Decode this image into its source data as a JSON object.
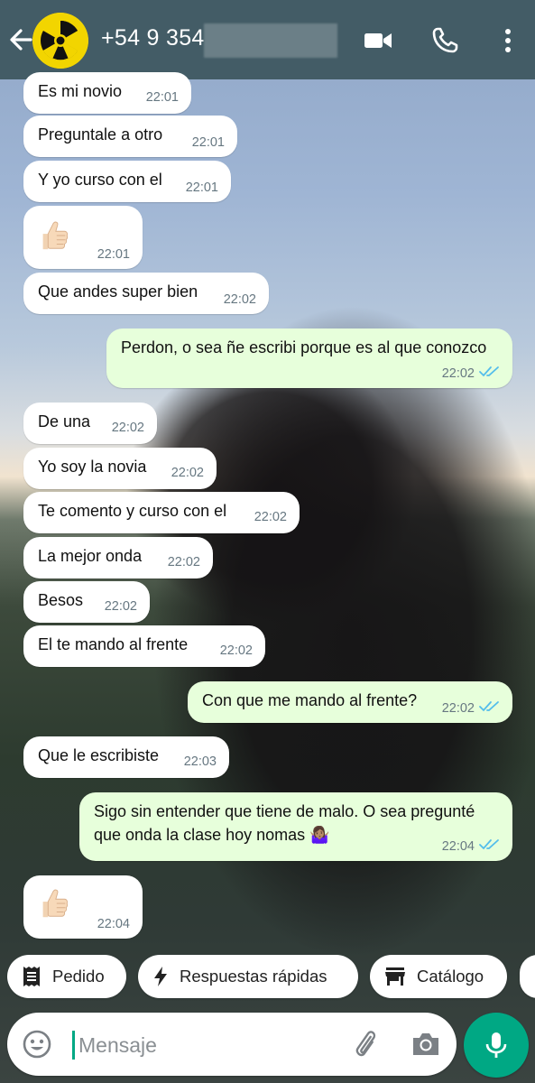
{
  "header": {
    "contact_name": "+54 9 354",
    "colors": {
      "header_bg": "#435c66",
      "avatar_bg": "#f2d500"
    },
    "icons": [
      "back-arrow-icon",
      "radiation-icon",
      "video-call-icon",
      "phone-icon",
      "more-vert-icon"
    ]
  },
  "messages": [
    {
      "dir": "in",
      "text": "Es mi novio",
      "time": "22:01"
    },
    {
      "dir": "in",
      "text": "Preguntale a otro",
      "time": "22:01"
    },
    {
      "dir": "in",
      "text": "Y yo curso con el",
      "time": "22:01"
    },
    {
      "dir": "in",
      "text": "👍",
      "emoji": "thumbs-up-icon",
      "time": "22:01"
    },
    {
      "dir": "in",
      "text": "Que andes super bien",
      "time": "22:02"
    },
    {
      "dir": "out",
      "text": "Perdon, o sea ñe escribi porque es al que conozco",
      "time": "22:02",
      "status": "read"
    },
    {
      "dir": "in",
      "text": "De una",
      "time": "22:02"
    },
    {
      "dir": "in",
      "text": "Yo soy la novia",
      "time": "22:02"
    },
    {
      "dir": "in",
      "text": "Te comento y curso con el",
      "time": "22:02"
    },
    {
      "dir": "in",
      "text": "La mejor onda",
      "time": "22:02"
    },
    {
      "dir": "in",
      "text": "Besos",
      "time": "22:02"
    },
    {
      "dir": "in",
      "text": "El te mando al frente",
      "time": "22:02"
    },
    {
      "dir": "out",
      "text": "Con que me mando al frente?",
      "time": "22:02",
      "status": "read"
    },
    {
      "dir": "in",
      "text": "Que le escribiste",
      "time": "22:03"
    },
    {
      "dir": "out",
      "text_line1": "Sigo sin entender que tiene de malo. O sea pregunté",
      "text_line2": "que onda la clase hoy nomas 🤷🏽‍♀️",
      "time": "22:04",
      "status": "read"
    },
    {
      "dir": "in",
      "text": "👍",
      "emoji": "thumbs-up-icon",
      "time": "22:04"
    }
  ],
  "quick_replies": [
    {
      "label": "Pedido",
      "icon": "receipt-icon"
    },
    {
      "label": "Respuestas rápidas",
      "icon": "lightning-icon"
    },
    {
      "label": "Catálogo",
      "icon": "store-icon"
    }
  ],
  "composer": {
    "placeholder": "Mensaje",
    "icons": [
      "emoji-icon",
      "attach-icon",
      "camera-icon",
      "mic-icon"
    ],
    "colors": {
      "accent": "#00a884",
      "read_ticks": "#53bdeb",
      "outgoing_bubble": "#e7ffdb",
      "incoming_bubble": "#ffffff"
    }
  }
}
